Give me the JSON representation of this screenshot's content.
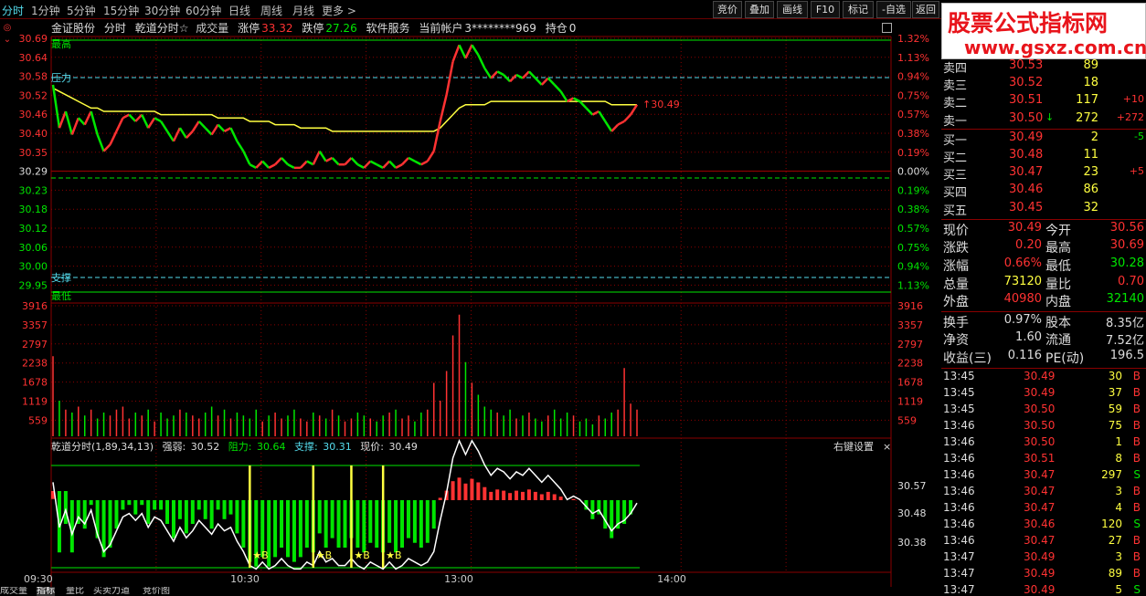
{
  "period_tabs": [
    "分时",
    "1分钟",
    "5分钟",
    "15分钟",
    "30分钟",
    "60分钟",
    "日线",
    "周线",
    "月线",
    "更多 >"
  ],
  "toolbar": [
    "竞价",
    "叠加",
    "画线",
    "F10",
    "标记",
    "-自选",
    "返回"
  ],
  "watermark": {
    "title": "股票公式指标网",
    "url": "www.gsxz.com.cn"
  },
  "header": {
    "stock": "金证股份",
    "mode": "分时",
    "indicator": "乾道分时☆",
    "volume_label": "成交量",
    "limit_up_label": "涨停",
    "limit_up": "33.32",
    "limit_down_label": "跌停",
    "limit_down": "27.26",
    "sector": "软件服务",
    "account_label": "当前帐户",
    "account": "3********969",
    "position_label": "持仓",
    "position": "0"
  },
  "price_axis": {
    "left": [
      "30.69",
      "30.64",
      "30.58",
      "30.52",
      "30.46",
      "30.40",
      "30.35",
      "30.29",
      "30.23",
      "30.18",
      "30.12",
      "30.06",
      "30.00",
      "29.95"
    ],
    "right": [
      "1.32%",
      "1.13%",
      "0.94%",
      "0.75%",
      "0.57%",
      "0.38%",
      "0.19%",
      "0.00%",
      "0.19%",
      "0.38%",
      "0.57%",
      "0.75%",
      "0.94%",
      "1.13%"
    ]
  },
  "volume_axis": [
    "3916",
    "3357",
    "2797",
    "2238",
    "1678",
    "1119",
    "559"
  ],
  "annotations": {
    "high": "最高",
    "low": "最低",
    "resistance": "压力",
    "support": "支撑",
    "last_price_tag": "↑30.49"
  },
  "indicator_title": {
    "name": "乾道分时(1,89,34,13)",
    "strength_label": "强弱:",
    "strength": "30.52",
    "resist_label": "阻力:",
    "resist": "30.64",
    "support_label": "支撑:",
    "support": "30.31",
    "price_label": "现价:",
    "price": "30.49"
  },
  "indicator_axis": [
    "30.57",
    "30.48",
    "30.38"
  ],
  "right_settings": "右键设置",
  "time_axis": [
    "09:30",
    "10:30",
    "13:00",
    "14:00"
  ],
  "bottom_tabs": [
    "成交量",
    "指标",
    "量比",
    "买卖力道",
    "竞价图"
  ],
  "colors": {
    "up": "#ff3232",
    "down": "#00e600",
    "avg": "#ffff40",
    "grid": "#8a0000",
    "cyan": "#55ddee",
    "label": "#c0c0c0"
  },
  "order_book": {
    "sells": [
      {
        "label": "卖四",
        "price": "30.53",
        "vol": "89",
        "chg": ""
      },
      {
        "label": "卖三",
        "price": "30.52",
        "vol": "18",
        "chg": ""
      },
      {
        "label": "卖二",
        "price": "30.51",
        "vol": "117",
        "chg": "+10"
      },
      {
        "label": "卖一",
        "price": "30.50",
        "arrow": "↓",
        "vol": "272",
        "chg": "+272"
      }
    ],
    "buys": [
      {
        "label": "买一",
        "price": "30.49",
        "vol": "2",
        "chg": "-5"
      },
      {
        "label": "买二",
        "price": "30.48",
        "vol": "11",
        "chg": ""
      },
      {
        "label": "买三",
        "price": "30.47",
        "vol": "23",
        "chg": "+5"
      },
      {
        "label": "买四",
        "price": "30.46",
        "vol": "86",
        "chg": ""
      },
      {
        "label": "买五",
        "price": "30.45",
        "vol": "32",
        "chg": ""
      }
    ]
  },
  "stats": [
    {
      "l1": "现价",
      "v1": "30.49",
      "l2": "今开",
      "v2": "30.56"
    },
    {
      "l1": "涨跌",
      "v1": "0.20",
      "l2": "最高",
      "v2": "30.69"
    },
    {
      "l1": "涨幅",
      "v1": "0.66%",
      "l2": "最低",
      "v2": "30.28"
    },
    {
      "l1": "总量",
      "v1": "73120",
      "l2": "量比",
      "v2": "0.70"
    },
    {
      "l1": "外盘",
      "v1": "40980",
      "l2": "内盘",
      "v2": "32140"
    }
  ],
  "fundamentals": [
    {
      "l1": "换手",
      "v1": "0.97%",
      "l2": "股本",
      "v2": "8.35亿"
    },
    {
      "l1": "净资",
      "v1": "1.60",
      "l2": "流通",
      "v2": "7.52亿"
    },
    {
      "l1": "收益(三)",
      "v1": "0.116",
      "l2": "PE(动)",
      "v2": "196.5"
    }
  ],
  "ticks": [
    {
      "t": "13:45",
      "p": "30.49",
      "v": "30",
      "s": "B"
    },
    {
      "t": "13:45",
      "p": "30.49",
      "v": "37",
      "s": "B"
    },
    {
      "t": "13:45",
      "p": "30.50",
      "v": "59",
      "s": "B"
    },
    {
      "t": "13:46",
      "p": "30.50",
      "v": "75",
      "s": "B"
    },
    {
      "t": "13:46",
      "p": "30.50",
      "v": "1",
      "s": "B"
    },
    {
      "t": "13:46",
      "p": "30.51",
      "v": "8",
      "s": "B"
    },
    {
      "t": "13:46",
      "p": "30.47",
      "v": "297",
      "s": "S"
    },
    {
      "t": "13:46",
      "p": "30.47",
      "v": "3",
      "s": "B"
    },
    {
      "t": "13:46",
      "p": "30.47",
      "v": "4",
      "s": "B"
    },
    {
      "t": "13:46",
      "p": "30.46",
      "v": "120",
      "s": "S"
    },
    {
      "t": "13:46",
      "p": "30.47",
      "v": "27",
      "s": "B"
    },
    {
      "t": "13:47",
      "p": "30.49",
      "v": "3",
      "s": "B"
    },
    {
      "t": "13:47",
      "p": "30.49",
      "v": "89",
      "s": "B"
    },
    {
      "t": "13:47",
      "p": "30.49",
      "v": "5",
      "s": "S"
    }
  ],
  "chart_data": {
    "type": "line",
    "price_series": {
      "name": "",
      "x_start": "09:30",
      "values": [
        30.55,
        30.42,
        30.47,
        30.4,
        30.45,
        30.43,
        30.47,
        30.4,
        30.35,
        30.37,
        30.41,
        30.45,
        30.46,
        30.44,
        30.46,
        30.42,
        30.45,
        30.44,
        30.41,
        30.38,
        30.42,
        30.39,
        30.41,
        30.44,
        30.42,
        30.4,
        30.43,
        30.41,
        30.42,
        30.38,
        30.35,
        30.31,
        30.3,
        30.32,
        30.3,
        30.31,
        30.33,
        30.31,
        30.3,
        30.3,
        30.32,
        30.31,
        30.35,
        30.32,
        30.33,
        30.31,
        30.31,
        30.33,
        30.31,
        30.3,
        30.32,
        30.31,
        30.3,
        30.32,
        30.3,
        30.31,
        30.33,
        30.32,
        30.31,
        30.32,
        30.35,
        30.44,
        30.52,
        30.62,
        30.67,
        30.63,
        30.67,
        30.64,
        30.6,
        30.57,
        30.59,
        30.58,
        30.56,
        30.58,
        30.57,
        30.59,
        30.57,
        30.55,
        30.57,
        30.55,
        30.53,
        30.5,
        30.51,
        30.5,
        30.48,
        30.46,
        30.47,
        30.44,
        30.41,
        30.43,
        30.44,
        30.46,
        30.49
      ]
    },
    "avg_series": {
      "name": "",
      "values": [
        30.54,
        30.53,
        30.52,
        30.51,
        30.5,
        30.49,
        30.48,
        30.48,
        30.47,
        30.47,
        30.47,
        30.47,
        30.47,
        30.47,
        30.47,
        30.47,
        30.47,
        30.46,
        30.46,
        30.46,
        30.46,
        30.46,
        30.46,
        30.46,
        30.46,
        30.46,
        30.45,
        30.45,
        30.45,
        30.45,
        30.45,
        30.44,
        30.44,
        30.44,
        30.44,
        30.43,
        30.43,
        30.43,
        30.43,
        30.42,
        30.42,
        30.42,
        30.42,
        30.42,
        30.41,
        30.41,
        30.41,
        30.41,
        30.41,
        30.41,
        30.41,
        30.41,
        30.41,
        30.41,
        30.41,
        30.41,
        30.41,
        30.41,
        30.41,
        30.41,
        30.41,
        30.42,
        30.44,
        30.46,
        30.48,
        30.49,
        30.49,
        30.49,
        30.49,
        30.5,
        30.5,
        30.5,
        30.5,
        30.5,
        30.5,
        30.5,
        30.5,
        30.5,
        30.5,
        30.5,
        30.5,
        30.5,
        30.5,
        30.5,
        30.5,
        30.5,
        30.5,
        30.5,
        30.49,
        30.49,
        30.49,
        30.49,
        30.49
      ]
    },
    "volume_series": {
      "name": "",
      "values": [
        2700,
        1200,
        900,
        800,
        1000,
        700,
        900,
        600,
        800,
        700,
        900,
        1000,
        600,
        800,
        700,
        900,
        500,
        800,
        600,
        700,
        900,
        800,
        700,
        600,
        800,
        1000,
        700,
        900,
        600,
        800,
        700,
        600,
        900,
        500,
        700,
        800,
        600,
        700,
        900,
        600,
        500,
        800,
        700,
        600,
        900,
        700,
        500,
        600,
        800,
        700,
        600,
        500,
        700,
        800,
        900,
        600,
        700,
        500,
        800,
        900,
        1800,
        1200,
        2200,
        3400,
        4100,
        2500,
        1800,
        1400,
        1000,
        900,
        800,
        700,
        900,
        600,
        700,
        800,
        600,
        500,
        700,
        900,
        600,
        800,
        700,
        500,
        600,
        400,
        700,
        600,
        800,
        900,
        2300,
        1100,
        900
      ]
    },
    "ylim": [
      29.95,
      30.69
    ],
    "ylabel": "",
    "xlabel": ""
  }
}
